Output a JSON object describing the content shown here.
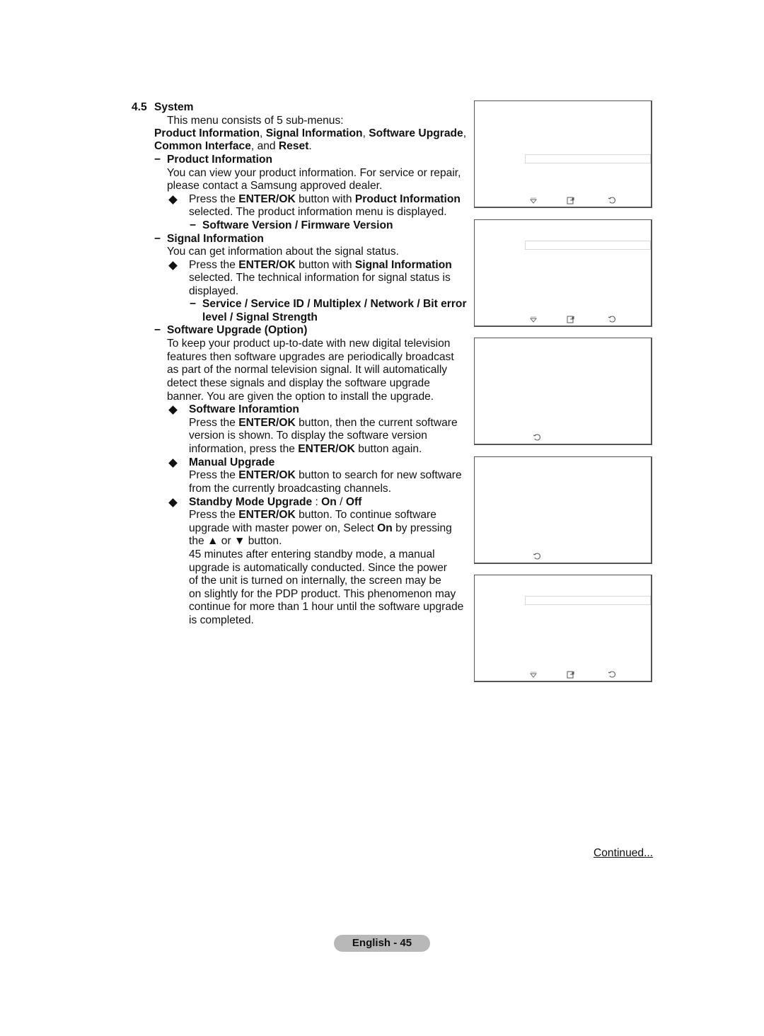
{
  "section": {
    "number": "4.5",
    "title": "System",
    "intro": "This menu consists of 5 sub-menus:",
    "submenus_line1": [
      {
        "text": "Product Information",
        "bold": true
      },
      {
        "text": ", ",
        "bold": false
      },
      {
        "text": "Signal Information",
        "bold": true
      },
      {
        "text": ", ",
        "bold": false
      },
      {
        "text": "Software Upgrade",
        "bold": true
      },
      {
        "text": ",",
        "bold": false
      }
    ],
    "submenus_line2": [
      {
        "text": "Common Interface",
        "bold": true
      },
      {
        "text": ", and ",
        "bold": false
      },
      {
        "text": "Reset",
        "bold": true
      },
      {
        "text": ".",
        "bold": false
      }
    ]
  },
  "product_information": {
    "heading": "Product Information",
    "desc_line1": "You can view your product information. For service or repair,",
    "desc_line2": "please contact a Samsung approved dealer.",
    "bullet_line1": [
      {
        "text": "Press the ",
        "bold": false
      },
      {
        "text": "ENTER/OK",
        "bold": true
      },
      {
        "text": " button with ",
        "bold": false
      },
      {
        "text": "Product Information",
        "bold": true
      }
    ],
    "bullet_line2": "selected. The product information menu is displayed.",
    "sub_item": "Software Version / Firmware Version"
  },
  "signal_information": {
    "heading": "Signal Information",
    "desc_line1": "You can get information about the signal status.",
    "bullet_line1": [
      {
        "text": "Press the ",
        "bold": false
      },
      {
        "text": "ENTER/OK",
        "bold": true
      },
      {
        "text": " button with ",
        "bold": false
      },
      {
        "text": "Signal Information",
        "bold": true
      }
    ],
    "bullet_line2": "selected. The technical information for signal status is",
    "bullet_line3": "displayed.",
    "sub_item_line1": "Service / Service ID / Multiplex / Network / Bit error",
    "sub_item_line2": "level / Signal Strength"
  },
  "software_upgrade": {
    "heading": "Software Upgrade (Option)",
    "desc_lines": [
      "To keep your product up-to-date with new digital television",
      "features then software upgrades are periodically broadcast",
      "as part of the normal television signal. It will automatically",
      "detect these signals and display the software upgrade",
      "banner. You are given the option to install the upgrade."
    ],
    "software_information": {
      "heading": "Software Inforamtion",
      "line1": [
        {
          "text": "Press the ",
          "bold": false
        },
        {
          "text": "ENTER/OK",
          "bold": true
        },
        {
          "text": " button, then the current software",
          "bold": false
        }
      ],
      "line2": "version is shown. To display the software version",
      "line3": [
        {
          "text": "information, press the ",
          "bold": false
        },
        {
          "text": "ENTER/OK",
          "bold": true
        },
        {
          "text": " button again.",
          "bold": false
        }
      ]
    },
    "manual_upgrade": {
      "heading": "Manual Upgrade",
      "line1": [
        {
          "text": "Press the ",
          "bold": false
        },
        {
          "text": "ENTER/OK",
          "bold": true
        },
        {
          "text": " button to search for new software",
          "bold": false
        }
      ],
      "line2": "from the currently broadcasting channels."
    },
    "standby_mode_upgrade": {
      "heading": [
        {
          "text": "Standby Mode Upgrade",
          "bold": true
        },
        {
          "text": " : ",
          "bold": false
        },
        {
          "text": "On",
          "bold": true
        },
        {
          "text": " / ",
          "bold": false
        },
        {
          "text": "Off",
          "bold": true
        }
      ],
      "line1": [
        {
          "text": "Press the ",
          "bold": false
        },
        {
          "text": "ENTER/OK",
          "bold": true
        },
        {
          "text": " button. To continue software",
          "bold": false
        }
      ],
      "line2": [
        {
          "text": "upgrade with master power on, Select ",
          "bold": false
        },
        {
          "text": "On",
          "bold": true
        },
        {
          "text": " by pressing",
          "bold": false
        }
      ],
      "line3": "the ▲ or ▼ button.",
      "note_lines": [
        "45 minutes after entering standby mode, a manual",
        "upgrade is automatically conducted. Since the power",
        "of the unit is turned on internally, the screen may be",
        "on slightly for the PDP product. This phenomenon may",
        "continue for more than 1 hour until the software upgrade",
        "is completed."
      ]
    }
  },
  "screenshots": [
    {
      "name": "product-information-screen",
      "has_field": true,
      "icons": [
        "move-icon",
        "enter-icon",
        "return-icon"
      ]
    },
    {
      "name": "signal-information-screen",
      "has_field": true,
      "icons": [
        "move-icon",
        "enter-icon",
        "return-icon"
      ]
    },
    {
      "name": "software-information-screen",
      "has_field": false,
      "icons": [
        "return-icon"
      ]
    },
    {
      "name": "manual-upgrade-screen",
      "has_field": false,
      "icons": [
        "return-icon"
      ]
    },
    {
      "name": "standby-mode-upgrade-screen",
      "has_field": true,
      "icons": [
        "move-icon",
        "enter-icon",
        "return-icon"
      ]
    }
  ],
  "footer": {
    "continued": "Continued...",
    "page_label": "English - 45"
  }
}
